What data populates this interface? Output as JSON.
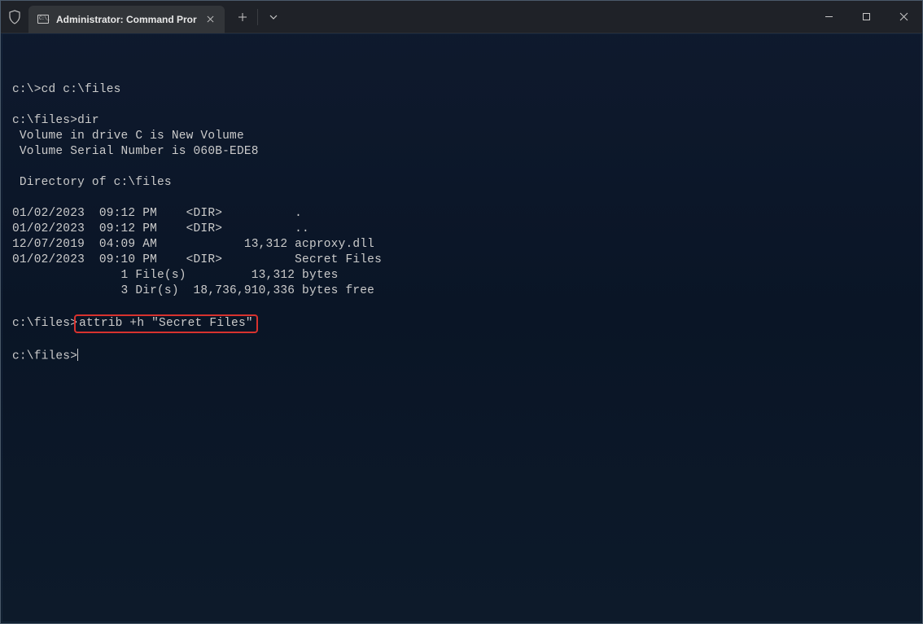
{
  "titlebar": {
    "tab": {
      "label": "Administrator: Command Pror"
    }
  },
  "terminal": {
    "lines": [
      {
        "type": "cmd",
        "prompt": "c:\\>",
        "text": "cd c:\\files"
      },
      {
        "type": "blank"
      },
      {
        "type": "cmd",
        "prompt": "c:\\files>",
        "text": "dir"
      },
      {
        "type": "out",
        "text": " Volume in drive C is New Volume"
      },
      {
        "type": "out",
        "text": " Volume Serial Number is 060B-EDE8"
      },
      {
        "type": "blank"
      },
      {
        "type": "out",
        "text": " Directory of c:\\files"
      },
      {
        "type": "blank"
      },
      {
        "type": "out",
        "text": "01/02/2023  09:12 PM    <DIR>          ."
      },
      {
        "type": "out",
        "text": "01/02/2023  09:12 PM    <DIR>          .."
      },
      {
        "type": "out",
        "text": "12/07/2019  04:09 AM            13,312 acproxy.dll"
      },
      {
        "type": "out",
        "text": "01/02/2023  09:10 PM    <DIR>          Secret Files"
      },
      {
        "type": "out",
        "text": "               1 File(s)         13,312 bytes"
      },
      {
        "type": "out",
        "text": "               3 Dir(s)  18,736,910,336 bytes free"
      },
      {
        "type": "blank"
      },
      {
        "type": "cmd-highlight",
        "prompt": "c:\\files>",
        "text": "attrib +h \"Secret Files\""
      },
      {
        "type": "blank"
      },
      {
        "type": "cmd-cursor",
        "prompt": "c:\\files>"
      }
    ]
  }
}
